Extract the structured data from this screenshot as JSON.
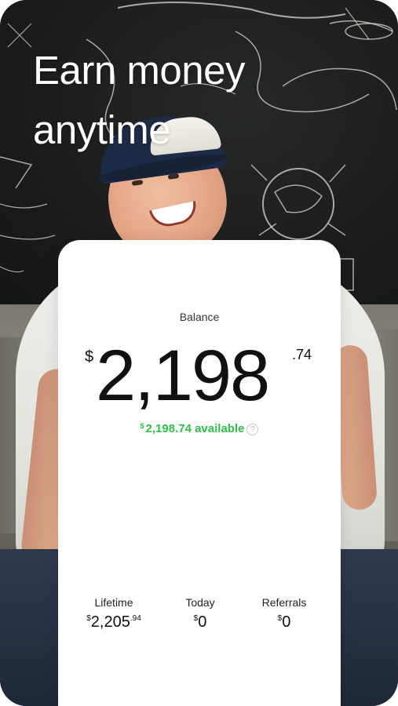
{
  "headline": {
    "line1": "Earn money",
    "line2": "anytime"
  },
  "card": {
    "balance_label": "Balance",
    "amount": {
      "currency": "$",
      "whole": "2,198",
      "cents": ".74"
    },
    "available": {
      "currency": "$",
      "amount": "2,198.74",
      "suffix": "available",
      "help_glyph": "?"
    },
    "stats": {
      "lifetime": {
        "label": "Lifetime",
        "currency": "$",
        "whole": "2,205",
        "cents": ".94"
      },
      "today": {
        "label": "Today",
        "currency": "$",
        "value": "0"
      },
      "referrals": {
        "label": "Referrals",
        "currency": "$",
        "value": "0"
      }
    }
  },
  "colors": {
    "accent_green": "#2fbf4a",
    "card_background": "#ffffff",
    "headline_text": "#ffffff"
  },
  "icons": {
    "help": "help-circle-icon"
  }
}
